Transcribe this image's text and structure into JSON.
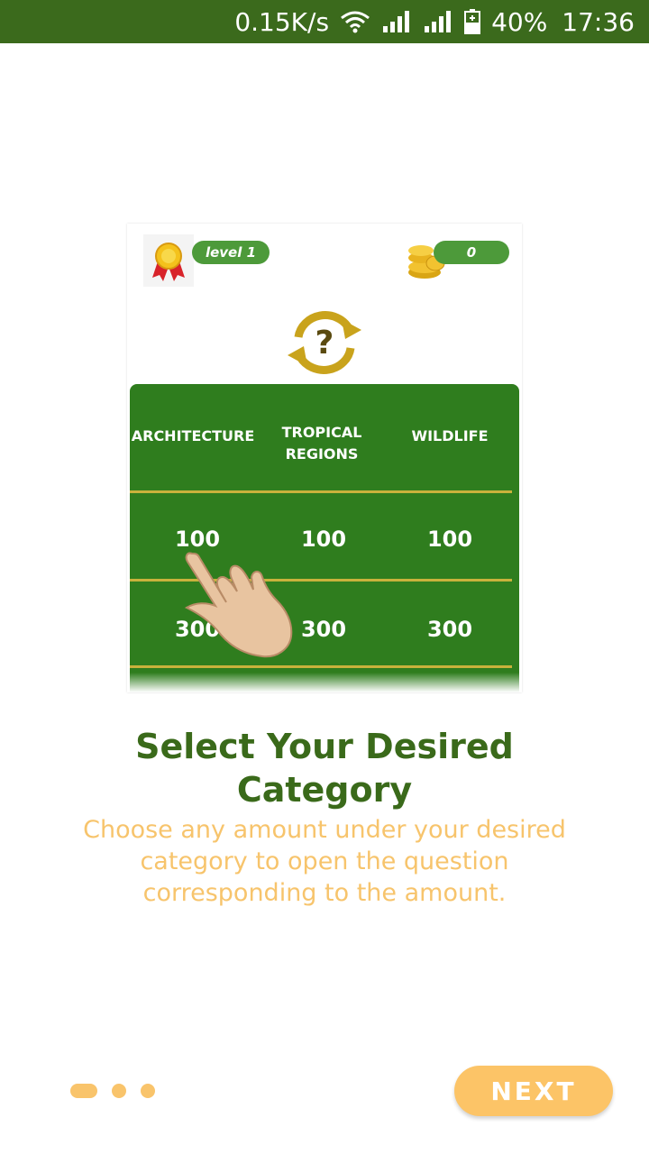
{
  "status_bar": {
    "speed": "0.15K/s",
    "battery": "40%",
    "time": "17:36",
    "icons": [
      "wifi-icon",
      "signal-icon",
      "signal-icon",
      "battery-charging-icon"
    ]
  },
  "illustration": {
    "level_label": "level  1",
    "coins": "0",
    "categories": [
      "ARCHITECTURE",
      "TROPICAL REGIONS",
      "WILDLIFE"
    ],
    "row1": [
      "100",
      "100",
      "100"
    ],
    "row2": [
      "300",
      "300",
      "300"
    ]
  },
  "content": {
    "title": "Select Your Desired Category",
    "description": "Choose any amount under your desired category to open the question corresponding to the amount."
  },
  "pagination": {
    "total": 3,
    "current": 1
  },
  "next_label": "NEXT",
  "colors": {
    "primary_green": "#3b6a1c",
    "board_green": "#2f7d1e",
    "accent_orange": "#fcc467"
  }
}
